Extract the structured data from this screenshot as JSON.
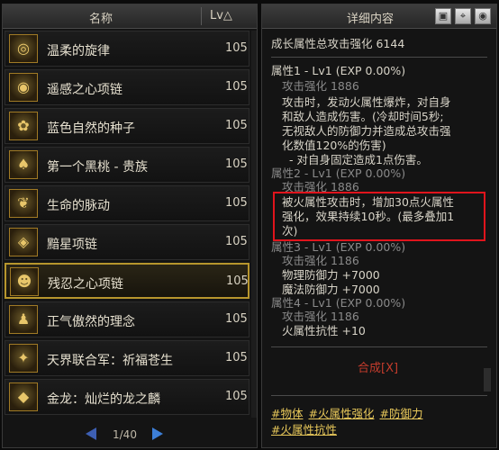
{
  "list_panel": {
    "header": {
      "name_col": "名称",
      "lv_col": "Lv△"
    },
    "items": [
      {
        "name": "温柔的旋律",
        "lv": "105",
        "icon": "swirl-icon"
      },
      {
        "name": "遥感之心项链",
        "lv": "105",
        "icon": "necklace-icon"
      },
      {
        "name": "蓝色自然的种子",
        "lv": "105",
        "icon": "seed-icon"
      },
      {
        "name": "第一个黑桃 - 贵族",
        "lv": "105",
        "icon": "spade-card-icon"
      },
      {
        "name": "生命的脉动",
        "lv": "105",
        "icon": "leaf-icon"
      },
      {
        "name": "黯星项链",
        "lv": "105",
        "icon": "necklace-icon"
      },
      {
        "name": "残忍之心项链",
        "lv": "105",
        "icon": "necklace-icon"
      },
      {
        "name": "正气傲然的理念",
        "lv": "105",
        "icon": "figures-icon"
      },
      {
        "name": "天界联合军：祈福苍生",
        "lv": "105",
        "icon": "emblem-icon"
      },
      {
        "name": "金龙：灿烂的龙之麟",
        "lv": "105",
        "icon": "dragon-scale-icon"
      }
    ],
    "selected_index": 6,
    "pager": {
      "page": "1/40"
    }
  },
  "detail_panel": {
    "header": {
      "title": "详细内容"
    },
    "lines": [
      "成长属性总攻击强化 6144",
      "属性1 - Lv1 (EXP 0.00%)",
      "攻击强化 1886",
      "攻击时，发动火属性爆炸，对自身",
      "和敌人造成伤害。(冷却时间5秒;",
      "无视敌人的防御力并造成总攻击强",
      "化数值120%的伤害)",
      "- 对自身固定造成1点伤害。",
      "属性2 - Lv1 (EXP 0.00%)",
      "攻击强化 1886",
      "被火属性攻击时，增加30点火属性",
      "强化，效果持续10秒。(最多叠加1",
      "次)",
      "属性3 - Lv1 (EXP 0.00%)",
      "攻击强化 1186",
      "物理防御力 +7000",
      "魔法防御力 +7000",
      "属性4 - Lv1 (EXP 0.00%)",
      "攻击强化 1186",
      "火属性抗性 +10"
    ],
    "compose_label": "合成[X]",
    "tags": [
      "#物体",
      "#火属性强化",
      "#防御力",
      "#火属性抗性"
    ]
  }
}
